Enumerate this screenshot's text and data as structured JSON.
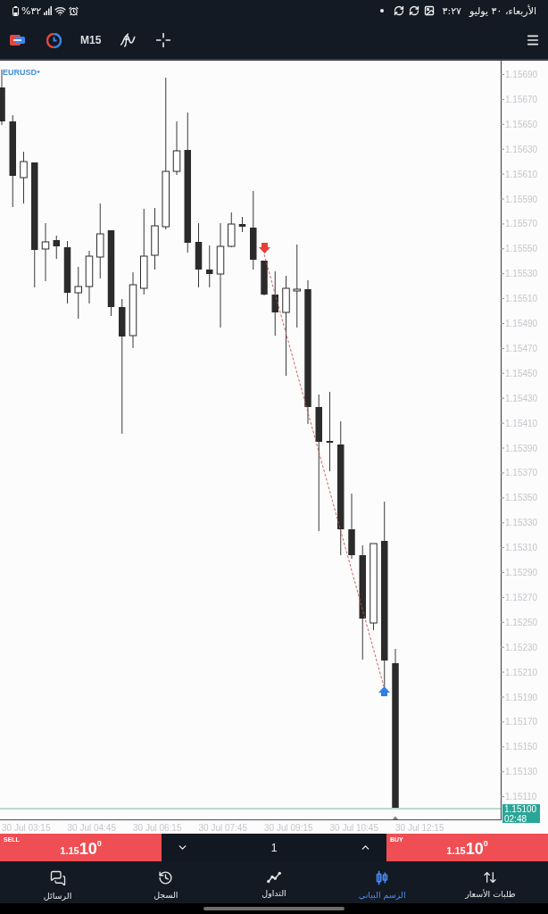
{
  "status_bar": {
    "battery": "%٣٢",
    "time": "٣:٢٧",
    "date": "الأربعاء، ٣٠ يوليو"
  },
  "toolbar": {
    "timeframe": "M15"
  },
  "chart": {
    "symbol": "EURUSD",
    "price_axis": [
      "1.15690",
      "1.15670",
      "1.15650",
      "1.15630",
      "1.15610",
      "1.15590",
      "1.15570",
      "1.15550",
      "1.15530",
      "1.15510",
      "1.15490",
      "1.15470",
      "1.15450",
      "1.15430",
      "1.15410",
      "1.15390",
      "1.15370",
      "1.15350",
      "1.15330",
      "1.15310",
      "1.15290",
      "1.15270",
      "1.15250",
      "1.15230",
      "1.15210",
      "1.15190",
      "1.15170",
      "1.15150",
      "1.15130",
      "1.15110"
    ],
    "time_axis": [
      "30 Jul 03:15",
      "30 Jul 04:45",
      "30 Jul 06:15",
      "30 Jul 07:45",
      "30 Jul 09:15",
      "30 Jul 10:45",
      "30 Jul 12:15"
    ],
    "price_tag": {
      "price": "1.15100",
      "countdown": "02:48"
    }
  },
  "trade_bar": {
    "sell": {
      "label": "SELL",
      "price": {
        "main": "1.15",
        "pips": "10",
        "fraction": "0"
      }
    },
    "volume": "1",
    "buy": {
      "label": "BUY",
      "price": {
        "main": "1.15",
        "pips": "10",
        "fraction": "0"
      }
    }
  },
  "bottom_nav": [
    {
      "label": "طلبات الأسعار",
      "selected": false
    },
    {
      "label": "الرسم البياني",
      "selected": true
    },
    {
      "label": "التداول",
      "selected": false
    },
    {
      "label": "السجل",
      "selected": false
    },
    {
      "label": "الرسائل",
      "selected": false
    }
  ]
}
